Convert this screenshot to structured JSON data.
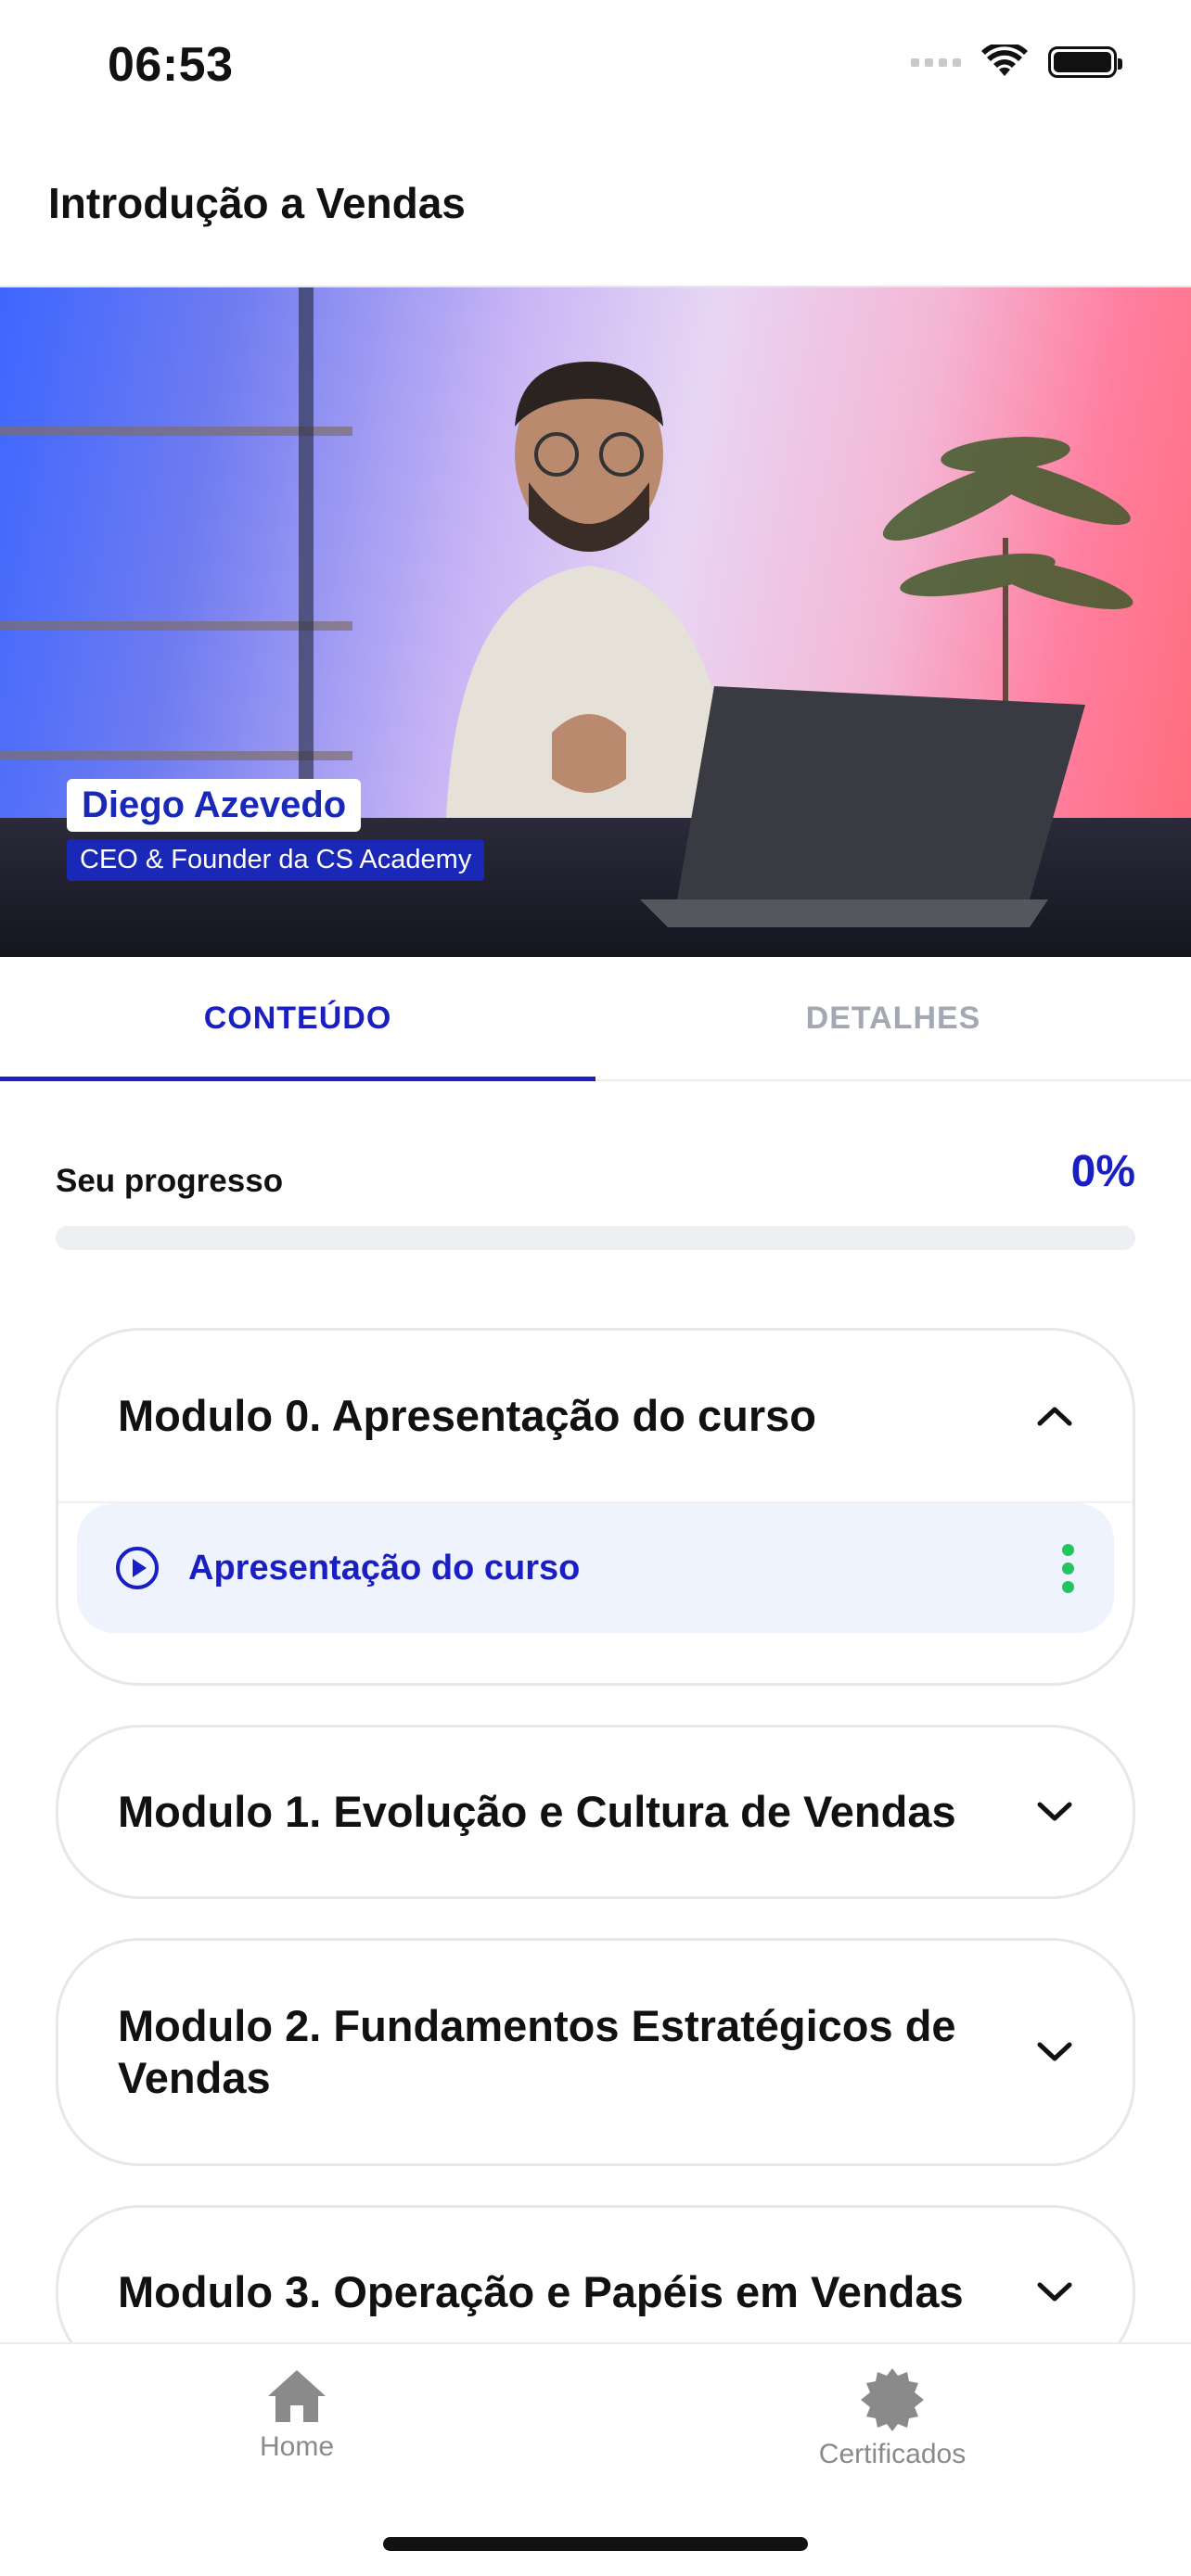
{
  "status_bar": {
    "time": "06:53"
  },
  "header": {
    "title": "Introdução a Vendas"
  },
  "video": {
    "speaker_name": "Diego Azevedo",
    "speaker_role": "CEO & Founder da CS Academy"
  },
  "tabs": [
    {
      "label": "CONTEÚDO",
      "active": true
    },
    {
      "label": "DETALHES",
      "active": false
    }
  ],
  "progress": {
    "label": "Seu progresso",
    "value_text": "0%",
    "value": 0
  },
  "modules": [
    {
      "title": "Modulo 0. Apresentação do curso",
      "expanded": true,
      "lessons": [
        {
          "title": "Apresentação do curso"
        }
      ]
    },
    {
      "title": "Modulo 1. Evolução e Cultura de Vendas",
      "expanded": false
    },
    {
      "title": "Modulo 2. Fundamentos Estratégicos de Vendas",
      "expanded": false
    },
    {
      "title": "Modulo 3. Operação e Papéis em Vendas",
      "expanded": false
    }
  ],
  "tabbar": {
    "home_label": "Home",
    "certificates_label": "Certificados"
  },
  "colors": {
    "accent": "#1a1fc4",
    "inactive": "#a3a8b3",
    "lesson_bg": "#eef3fd",
    "menu_dots": "#22c55e"
  },
  "icons": [
    "wifi-icon",
    "battery-icon",
    "signal-icon",
    "play-circle-icon",
    "chevron-up-icon",
    "chevron-down-icon",
    "more-vertical-icon",
    "home-icon",
    "certificate-badge-icon"
  ]
}
